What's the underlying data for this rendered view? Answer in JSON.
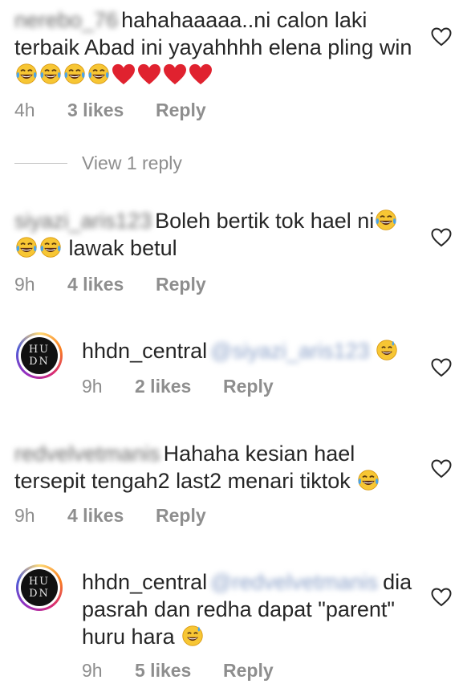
{
  "comments": [
    {
      "handle": "nerebo_76",
      "text_a": "hahahaaaaa..ni calon laki terbaik Abad ini yayahhhh elena pling win",
      "time": "4h",
      "likes": "3 likes",
      "reply": "Reply"
    },
    {
      "handle": "siyazi_aris123",
      "text_a": "Boleh bertik tok hael ni",
      "text_b": "lawak betul",
      "time": "9h",
      "likes": "4 likes",
      "reply": "Reply"
    },
    {
      "username": "hhdn_central",
      "mention": "@siyazi_aris123",
      "time": "9h",
      "likes": "2 likes",
      "reply": "Reply"
    },
    {
      "handle": "redvelvetmanis",
      "text_a": "Hahaha kesian hael tersepit tengah2 last2 menari tiktok",
      "time": "9h",
      "likes": "4 likes",
      "reply": "Reply"
    },
    {
      "username": "hhdn_central",
      "mention": "@redvelvetmanis",
      "text_a": "dia pasrah dan redha dapat \"parent\" huru hara",
      "time": "9h",
      "likes": "5 likes",
      "reply": "Reply"
    }
  ],
  "view_replies": "View 1 reply",
  "avatar": {
    "top": "HU",
    "bottom": "DN"
  },
  "icons": {
    "like": "heart-outline-icon",
    "laugh": "tears-of-joy-emoji",
    "sweat": "grinning-sweat-emoji",
    "heart": "red-heart-emoji"
  },
  "colors": {
    "text": "#262626",
    "meta": "#8e8e8e",
    "heart_red": "#e0222f",
    "emoji_yellow": "#f7c634"
  }
}
